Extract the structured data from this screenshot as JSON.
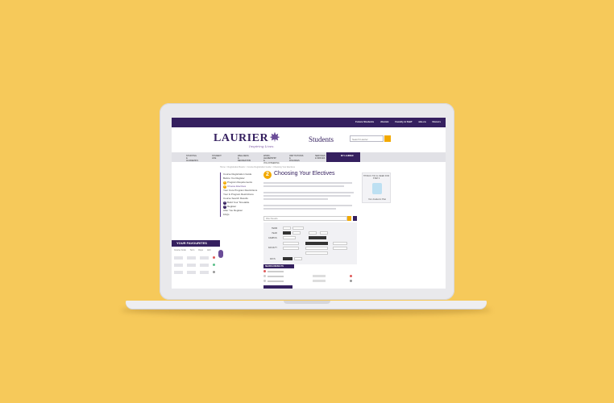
{
  "top_links": [
    "Future Students",
    "Alumni",
    "Faculty & Staff",
    "wlu.ca",
    "Donors"
  ],
  "header": {
    "logo": "LAURIER",
    "tagline": "Inspiring Lives.",
    "section": "Students",
    "search_placeholder": "Search Laurier"
  },
  "nav": [
    "STUDYING & ACADEMICS",
    "STUDENT LIFE",
    "WELLNESS & RECREATION",
    "WORK, LEADERSHIP & VOLUNTEERING",
    "INSTITUTIONS & FINANCES",
    "SERVICES & SPACES",
    "MY LAURIER"
  ],
  "breadcrumb": "Home > Registration Basics > Course Registration Guide > Choosing Your Electives",
  "leftnav": {
    "heading": "Course Registration Guide",
    "items": [
      {
        "num": "",
        "label": "Before You Register"
      },
      {
        "num": "1",
        "label": "Program Requirements"
      },
      {
        "num": "2",
        "label": "Choose Electives"
      },
      {
        "num": "",
        "label": "Your Core Program Restrictions"
      },
      {
        "num": "",
        "label": "Your & Program Restrictions"
      },
      {
        "num": "",
        "label": "Course Search Results"
      },
      {
        "num": "3",
        "label": "Build Your Timetable"
      },
      {
        "num": "4",
        "label": "Register"
      },
      {
        "num": "",
        "label": "After You Register"
      },
      {
        "num": "",
        "label": "FAQs"
      }
    ]
  },
  "favourites": {
    "title": "YOUR FAVOURITES",
    "columns": [
      "Course Code",
      "Term",
      "Days",
      "Add"
    ]
  },
  "main": {
    "step": "2",
    "title": "Choosing Your Electives",
    "filter_placeholder": "Filter Results",
    "filters": [
      "TERM",
      "YEAR",
      "CAMPUS",
      "FACULTY",
      "TIME & DAY",
      "DAYS"
    ],
    "search_results": "SEARCH RESULTS"
  },
  "ad": {
    "title": "THINGS YOU'LL NEED FOR STEP 2",
    "caption": "Your Academic Plan"
  },
  "colors": {
    "brand": "#35205f",
    "accent": "#f2a900",
    "background": "#f6c95a"
  }
}
